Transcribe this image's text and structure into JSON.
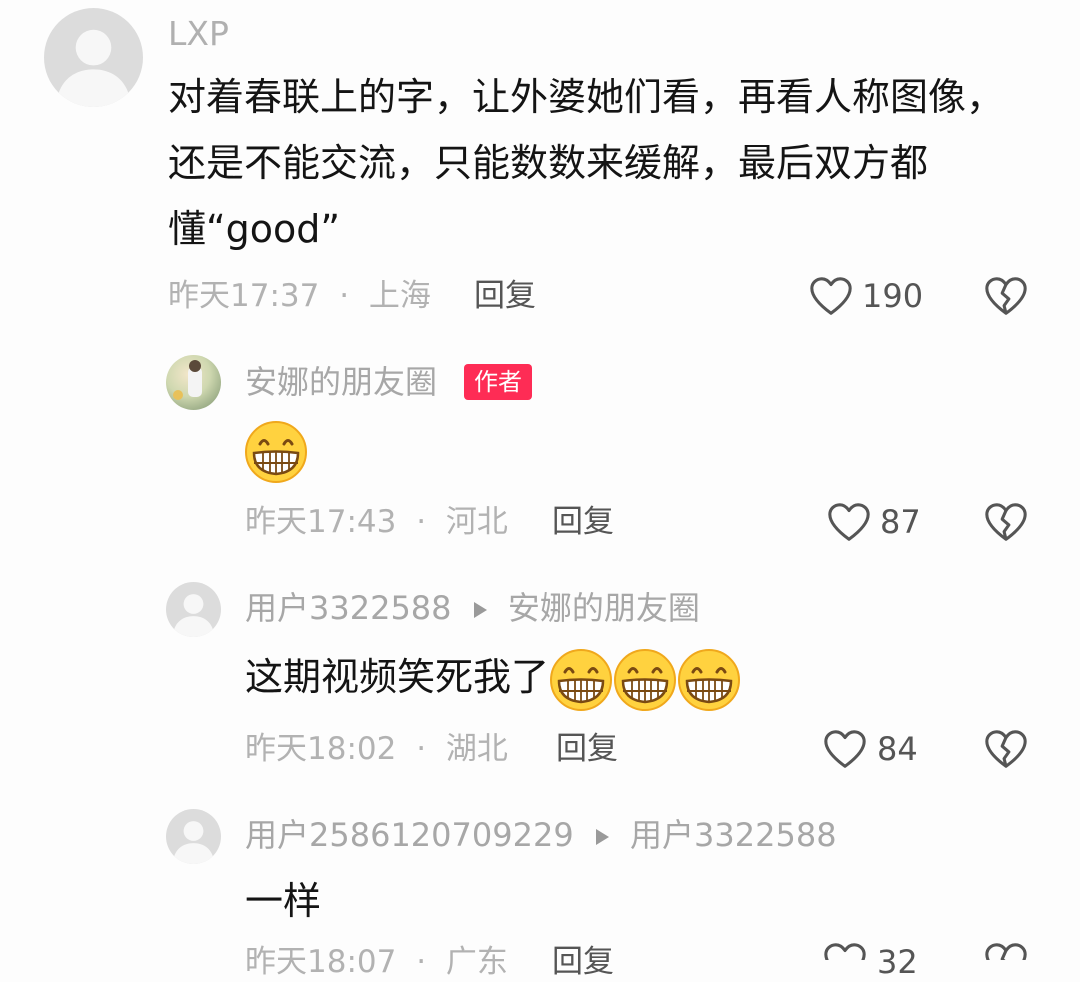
{
  "comments": [
    {
      "user": "LXP",
      "text": "对着春联上的字，让外婆她们看，再看人称图像，还是不能交流，只能数数来缓解，最后双方都懂“good”",
      "time": "昨天17:37",
      "location": "上海",
      "reply_label": "回复",
      "likes": "190"
    },
    {
      "user": "安娜的朋友圈",
      "author_tag": "作者",
      "time": "昨天17:43",
      "location": "河北",
      "reply_label": "回复",
      "likes": "87",
      "emoji_count": 1
    },
    {
      "user": "用户3322588",
      "reply_to": "安娜的朋友圈",
      "text": "这期视频笑死我了",
      "time": "昨天18:02",
      "location": "湖北",
      "reply_label": "回复",
      "likes": "84",
      "emoji_count": 3
    },
    {
      "user": "用户2586120709229",
      "reply_to": "用户3322588",
      "text": "一样",
      "time": "昨天18:07",
      "location": "广东",
      "reply_label": "回复",
      "likes": "32"
    }
  ],
  "separator": "·",
  "icons": {
    "like": "heart-outline-icon",
    "dislike": "broken-heart-icon",
    "reply_arrow": "triangle-right-icon",
    "emoji": "grinning-face-emoji"
  },
  "colors": {
    "author_tag_bg": "#fe2c55",
    "meta_gray": "#b2b2b2"
  }
}
